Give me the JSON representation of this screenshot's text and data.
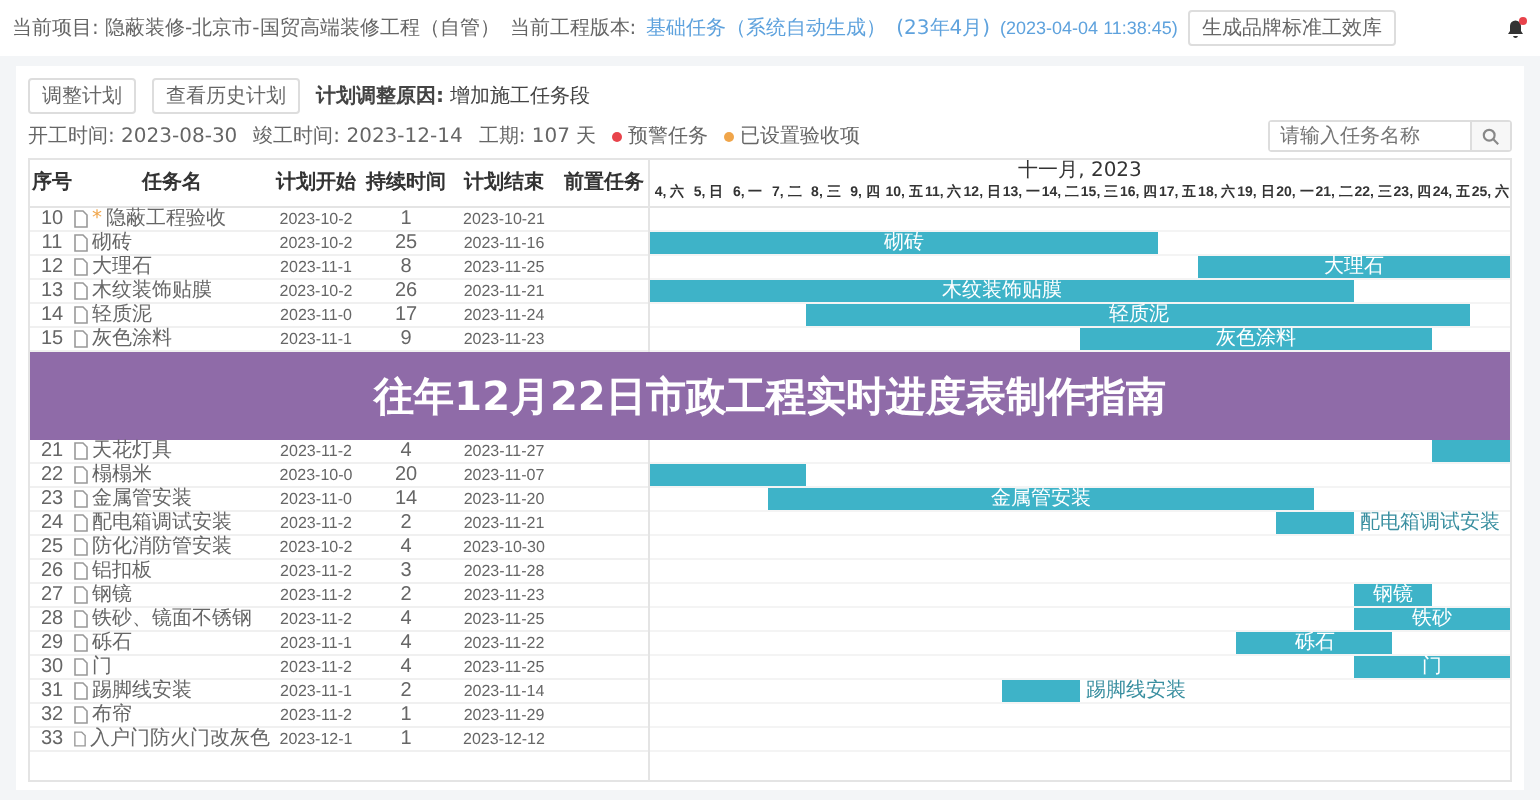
{
  "top_bar": {
    "project_label": "当前项目: 隐蔽装修-北京市-国贸高端装修工程（自管）",
    "version_label": "当前工程版本:",
    "version_name": "基础任务（系统自动生成）",
    "version_period": "(23年4月)",
    "version_time": "(2023-04-04 11:38:45)",
    "action_button": "生成品牌标准工效库",
    "notifications": true
  },
  "toolbar": {
    "buttons": [
      "调整计划",
      "查看历史计划"
    ],
    "reason": "**计划调整原因:** 增加施工任务段"
  },
  "info": {
    "start": "开工时间: 2023-08-30",
    "finish": "竣工时间: 2023-12-14",
    "duration": "工期: 107 天",
    "legend": [
      {
        "label": "预警任务",
        "color": "#e8434b"
      },
      {
        "label": "已设置验收项",
        "color": "#f0a54a"
      }
    ],
    "search": {
      "placeholder": "请输入任务名称"
    }
  },
  "table": {
    "columns": [
      "序号",
      "任务名",
      "计划开始",
      "持续时间",
      "计划结束",
      "前置任务"
    ],
    "rows_before": [
      {
        "no": "10",
        "mark": "*",
        "name": "隐蔽工程验收",
        "start": "2023-10-2",
        "duration": "1",
        "end": "2023-10-21"
      },
      {
        "no": "11",
        "name": "砌砖",
        "start": "2023-10-2",
        "duration": "25",
        "end": "2023-11-16",
        "bar_label": "砌砖"
      },
      {
        "no": "12",
        "name": "大理石",
        "start": "2023-11-1",
        "duration": "8",
        "end": "2023-11-25",
        "bar_label": "大理石"
      },
      {
        "no": "13",
        "name": "木纹装饰贴膜",
        "start": "2023-10-2",
        "duration": "26",
        "end": "2023-11-21",
        "bar_label": "木纹装饰贴膜"
      },
      {
        "no": "14",
        "name": "轻质泥",
        "start": "2023-11-0",
        "duration": "17",
        "end": "2023-11-24",
        "bar_label": "轻质泥"
      },
      {
        "no": "15",
        "name": "灰色涂料",
        "start": "2023-11-1",
        "duration": "9",
        "end": "2023-11-23",
        "bar_label": "灰色涂料"
      }
    ],
    "rows_after": [
      {
        "no": "21",
        "name": "天花灯具",
        "start": "2023-11-2",
        "duration": "4",
        "end": "2023-11-27"
      },
      {
        "no": "22",
        "name": "榻榻米",
        "start": "2023-10-0",
        "duration": "20",
        "end": "2023-11-07"
      },
      {
        "no": "23",
        "name": "金属管安装",
        "start": "2023-11-0",
        "duration": "14",
        "end": "2023-11-20",
        "bar_label": "金属管安装"
      },
      {
        "no": "24",
        "name": "配电箱调试安装",
        "start": "2023-11-2",
        "duration": "2",
        "end": "2023-11-21",
        "bar_label": "配电箱调试安装"
      },
      {
        "no": "25",
        "name": "防化消防管安装",
        "start": "2023-10-2",
        "duration": "4",
        "end": "2023-10-30"
      },
      {
        "no": "26",
        "name": "铝扣板",
        "start": "2023-11-2",
        "duration": "3",
        "end": "2023-11-28"
      },
      {
        "no": "27",
        "name": "钢镜",
        "start": "2023-11-2",
        "duration": "2",
        "end": "2023-11-23",
        "bar_label": "钢镜"
      },
      {
        "no": "28",
        "name": "铁砂、镜面不锈钢",
        "start": "2023-11-2",
        "duration": "4",
        "end": "2023-11-25",
        "bar_label": "铁砂"
      },
      {
        "no": "29",
        "name": "砾石",
        "start": "2023-11-1",
        "duration": "4",
        "end": "2023-11-22",
        "bar_label": "砾石"
      },
      {
        "no": "30",
        "name": "门",
        "start": "2023-11-2",
        "duration": "4",
        "end": "2023-11-25",
        "bar_label": "门"
      },
      {
        "no": "31",
        "name": "踢脚线安装",
        "start": "2023-11-1",
        "duration": "2",
        "end": "2023-11-14",
        "bar_label": "踢脚线安装"
      },
      {
        "no": "32",
        "name": "布帘",
        "start": "2023-11-2",
        "duration": "1",
        "end": "2023-11-29"
      },
      {
        "no": "33",
        "name": "入户门防火门改灰色",
        "start": "2023-12-1",
        "duration": "1",
        "end": "2023-12-12"
      }
    ]
  },
  "gantt": {
    "month": "十一月, 2023",
    "days": [
      "4, 六",
      "5, 日",
      "6, 一",
      "7, 二",
      "8, 三",
      "9, 四",
      "10, 五",
      "11, 六",
      "12, 日",
      "13, 一",
      "14, 二",
      "15, 三",
      "16, 四",
      "17, 五",
      "18, 六",
      "19, 日",
      "20, 一",
      "21, 二",
      "22, 三",
      "23, 四",
      "24, 五",
      "25, 六"
    ]
  },
  "banner": {
    "title": "往年12月22日市政工程实时进度表制作指南"
  }
}
